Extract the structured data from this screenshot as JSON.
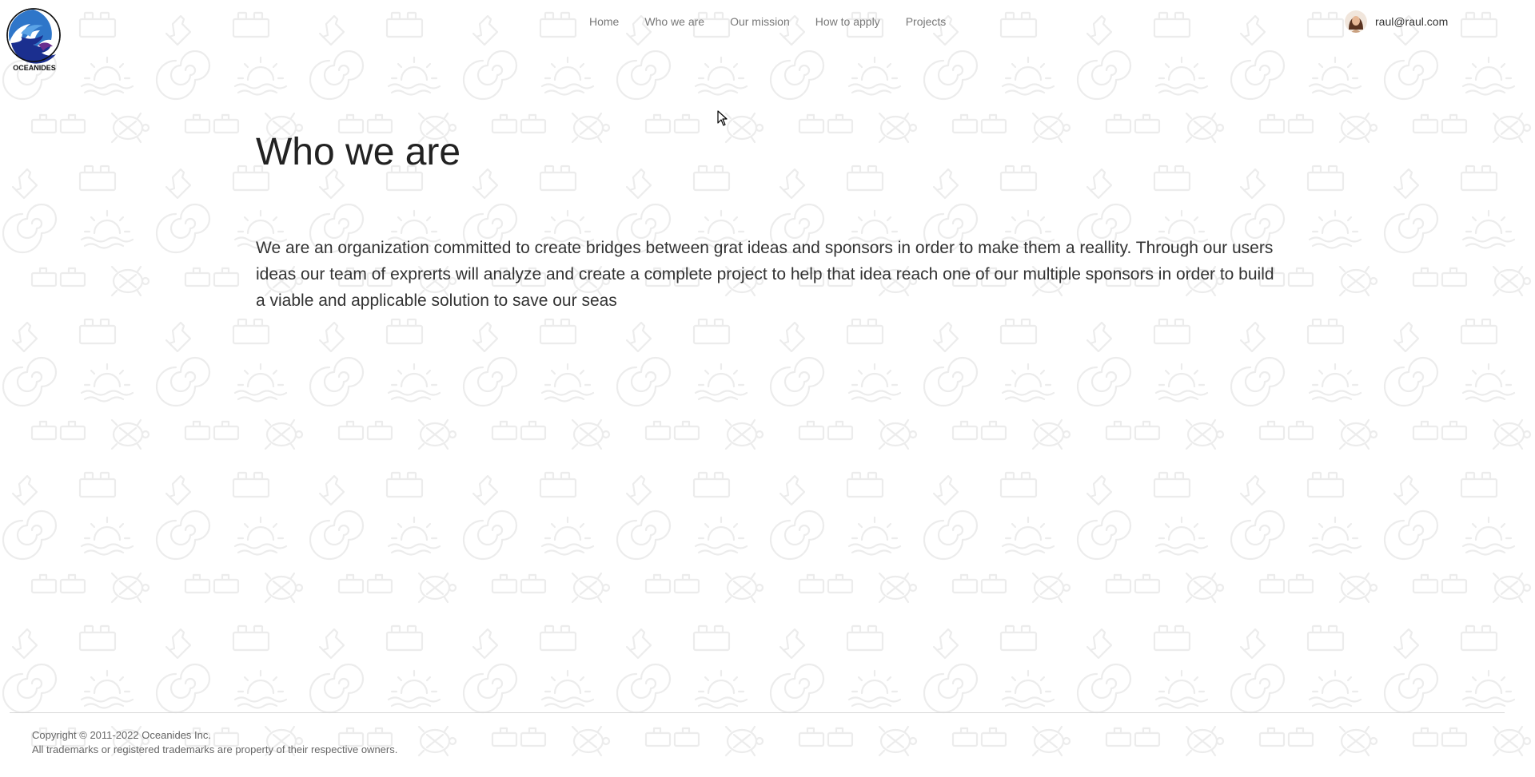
{
  "brand": {
    "name": "OCEANIDES",
    "logo_colors": [
      "#1b2f8f",
      "#2f76c9",
      "#5aa3e6",
      "#6a2e8f"
    ]
  },
  "nav": {
    "items": [
      {
        "label": "Home"
      },
      {
        "label": "Who we are"
      },
      {
        "label": "Our mission"
      },
      {
        "label": "How to apply"
      },
      {
        "label": "Projects"
      }
    ]
  },
  "user": {
    "email": "raul@raul.com",
    "avatar_icon": "user-avatar"
  },
  "main": {
    "title": "Who we are",
    "body": "We are an organization committed to create bridges between grat ideas and sponsors in order to make them a reallity. Through our users ideas our team of exprerts will analyze and create a complete project to help that idea reach one of our multiple sponsors in order to build a viable and applicable solution to save our seas"
  },
  "footer": {
    "copyright": "Copyright © 2011-2022 Oceanides Inc.",
    "trademarks": "All trademarks or registered trademarks are property of their respective owners."
  },
  "background": {
    "pattern_icons": [
      "shell-icon",
      "turtle-icon",
      "bottle-icon",
      "sun-wave-icon",
      "brick-icon"
    ],
    "pattern_color": "#eeeeee"
  }
}
